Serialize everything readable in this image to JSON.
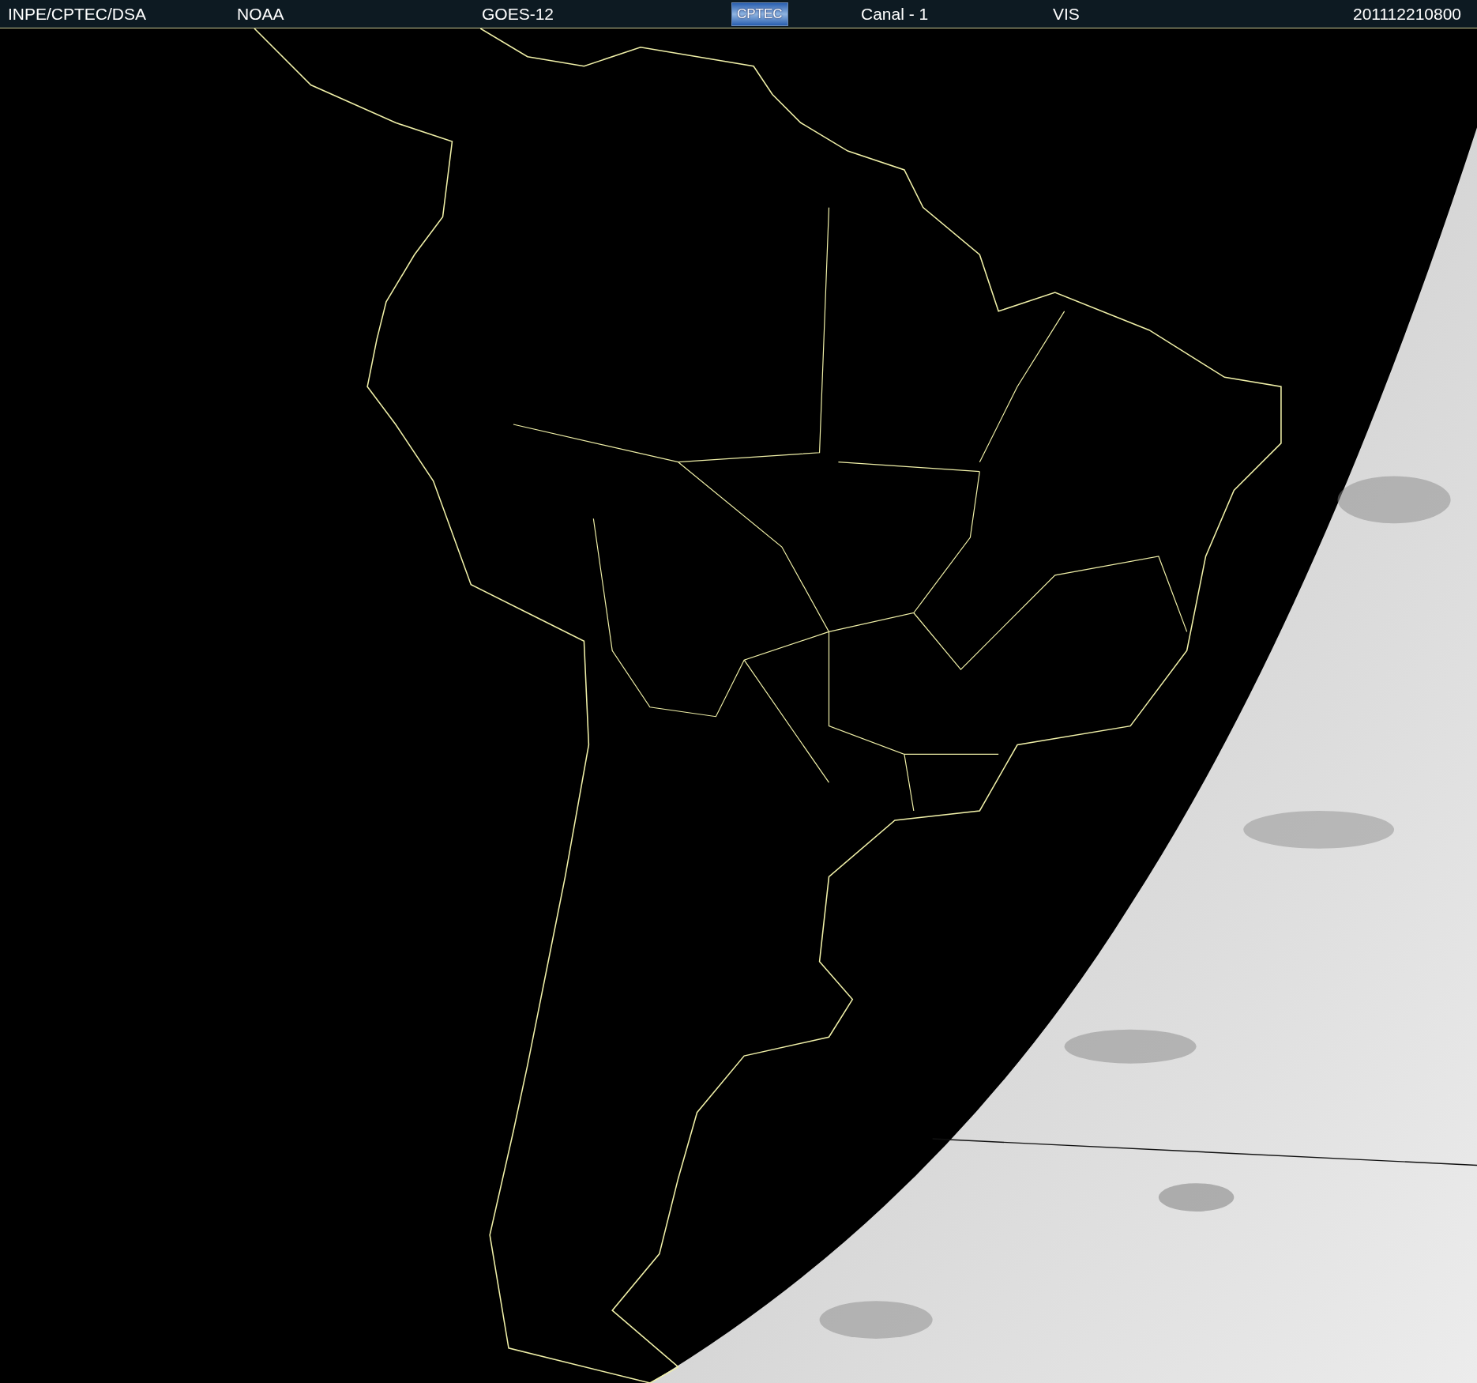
{
  "header": {
    "items": [
      {
        "kind": "text",
        "text": "INPE/CPTEC/DSA"
      },
      {
        "kind": "text",
        "text": "NOAA"
      },
      {
        "kind": "text",
        "text": "GOES-12"
      },
      {
        "kind": "logo",
        "text": "CPTEC"
      },
      {
        "kind": "text",
        "text": "Canal - 1"
      },
      {
        "kind": "text",
        "text": "VIS"
      },
      {
        "kind": "text",
        "text": "201112210800"
      }
    ]
  }
}
